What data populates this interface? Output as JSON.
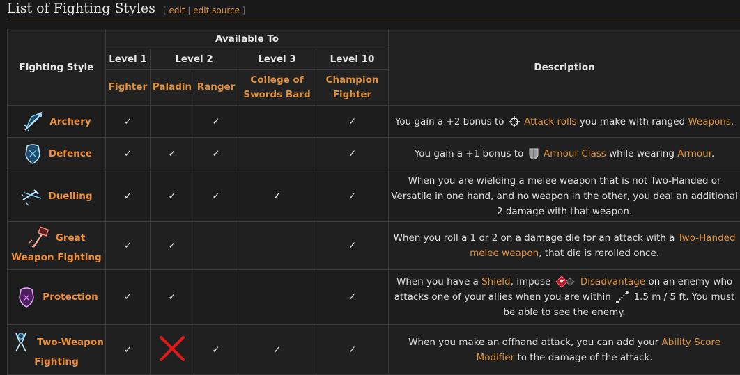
{
  "heading": {
    "title": "List of Fighting Styles",
    "bracket_open": "[",
    "edit": "edit",
    "separator": "|",
    "edit_source": "edit source",
    "bracket_close": "]"
  },
  "table": {
    "col_style": "Fighting Style",
    "col_available": "Available To",
    "col_description": "Description",
    "levels": [
      "Level 1",
      "Level 2",
      "Level 3",
      "Level 10"
    ],
    "classes": [
      "Fighter",
      "Paladin",
      "Ranger",
      "College of Swords Bard",
      "Champion Fighter"
    ],
    "check": "✓",
    "rows": [
      {
        "name": "Archery",
        "icon": "archery-icon",
        "avail": [
          "✓",
          "",
          "✓",
          "",
          "✓"
        ],
        "desc": {
          "a": "You gain a +2 bonus to",
          "link1": "Attack rolls",
          "b": "you make with ranged",
          "link2": "Weapons",
          "c": "."
        }
      },
      {
        "name": "Defence",
        "icon": "defence-icon",
        "avail": [
          "✓",
          "✓",
          "✓",
          "",
          "✓"
        ],
        "desc": {
          "a": "You gain a +1 bonus to",
          "link1": "Armour Class",
          "b": "while wearing",
          "link2": "Armour",
          "c": "."
        }
      },
      {
        "name": "Duelling",
        "icon": "duelling-icon",
        "avail": [
          "✓",
          "✓",
          "✓",
          "✓",
          "✓"
        ],
        "desc": {
          "a": "When you are wielding a melee weapon that is not Two-Handed or Versatile in one hand, and no weapon in the other, you deal an additional 2 damage with that weapon."
        }
      },
      {
        "name": "Great Weapon Fighting",
        "icon": "great-weapon-fighting-icon",
        "avail": [
          "✓",
          "✓",
          "",
          "",
          "✓"
        ],
        "desc": {
          "a": "When you roll a 1 or 2 on a damage die for an attack with a",
          "link1": "Two-Handed melee weapon",
          "b": ", that die is rerolled once."
        }
      },
      {
        "name": "Protection",
        "icon": "protection-icon",
        "avail": [
          "✓",
          "✓",
          "",
          "",
          "✓"
        ],
        "desc": {
          "a": "When you have a",
          "link1": "Shield",
          "b": ", impose",
          "link2": "Disadvantage",
          "c": "on an enemy who attacks one of your allies when you are within",
          "d": "1.5 m / 5 ft. You must be able to see the enemy."
        }
      },
      {
        "name": "Two-Weapon Fighting",
        "icon": "two-weapon-fighting-icon",
        "avail": [
          "✓",
          "✗",
          "✓",
          "✓",
          "✓"
        ],
        "desc": {
          "a": "When you make an offhand attack, you can add your",
          "link1": "Ability Score Modifier",
          "b": "to the damage of the attack."
        }
      }
    ]
  },
  "colors": {
    "accent": "#e0913a",
    "name": "#ef8f3a",
    "cross": "#e01919",
    "border": "#3b3b3b",
    "background": "#191919"
  }
}
